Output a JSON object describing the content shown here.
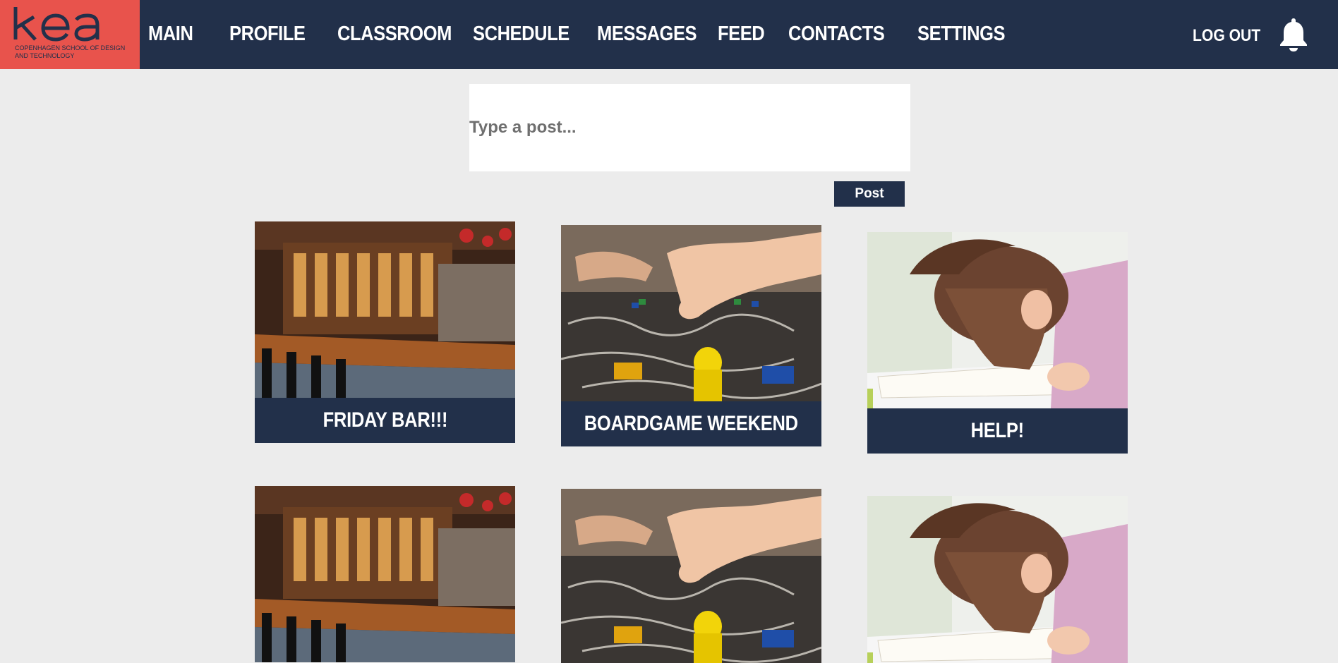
{
  "logo": {
    "mark": "KEA",
    "subtitle": "Copenhagen School of Design and Technology"
  },
  "nav": {
    "items": [
      {
        "label": "MAIN"
      },
      {
        "label": "PROFILE"
      },
      {
        "label": "CLASSROOM"
      },
      {
        "label": "SCHEDULE"
      },
      {
        "label": "MESSAGES"
      },
      {
        "label": "FEED"
      },
      {
        "label": "CONTACTS"
      },
      {
        "label": "SETTINGS"
      }
    ],
    "logout": "LOG OUT",
    "bell_icon": "bell-icon"
  },
  "post": {
    "placeholder": "Type a post...",
    "button": "Post"
  },
  "cards": [
    {
      "caption": "FRIDAY BAR!!!",
      "image": "bar-interior"
    },
    {
      "caption": "BOARDGAME WEEKEND",
      "image": "boardgame"
    },
    {
      "caption": "HELP!",
      "image": "tired-student"
    },
    {
      "caption": "",
      "image": "bar-interior"
    },
    {
      "caption": "",
      "image": "boardgame"
    },
    {
      "caption": "",
      "image": "tired-student"
    }
  ],
  "colors": {
    "nav": "#22304a",
    "logo_bg": "#e8534c",
    "page_bg": "#ececec"
  }
}
